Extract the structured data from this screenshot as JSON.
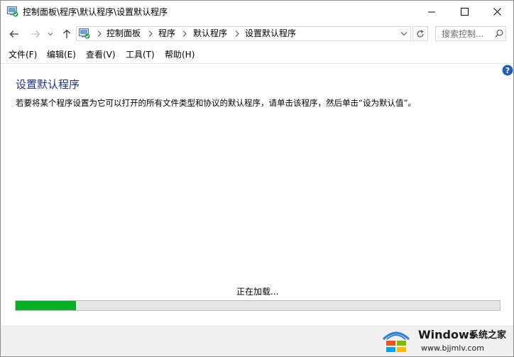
{
  "window": {
    "title": "控制面板\\程序\\默认程序\\设置默认程序"
  },
  "address_bar": {
    "crumbs": [
      "控制面板",
      "程序",
      "默认程序",
      "设置默认程序"
    ]
  },
  "search": {
    "placeholder": "搜索控制..."
  },
  "menu": {
    "items": [
      "文件(F)",
      "编辑(E)",
      "查看(V)",
      "工具(T)",
      "帮助(H)"
    ]
  },
  "content": {
    "title": "设置默认程序",
    "description": "若要将某个程序设置为它可以打开的所有文件类型和协议的默认程序，请单击该程序，然后单击“设为默认值”。",
    "loading_text": "正在加载...",
    "progress_fraction": 0.125
  },
  "colors": {
    "accent_title": "#1e3287",
    "progress_fill": "#06b025",
    "help_icon": "#1f5fb6"
  },
  "icons": {
    "app": "control-panel-icon",
    "back": "arrow-left-icon",
    "forward": "arrow-right-icon",
    "recent": "chevron-down-icon",
    "up": "arrow-up-icon",
    "refresh": "refresh-icon",
    "search": "search-icon",
    "help": "help-icon"
  },
  "watermark": {
    "brand": "Windows",
    "site": "系统之家",
    "url": "www.bjjmlv.com"
  }
}
